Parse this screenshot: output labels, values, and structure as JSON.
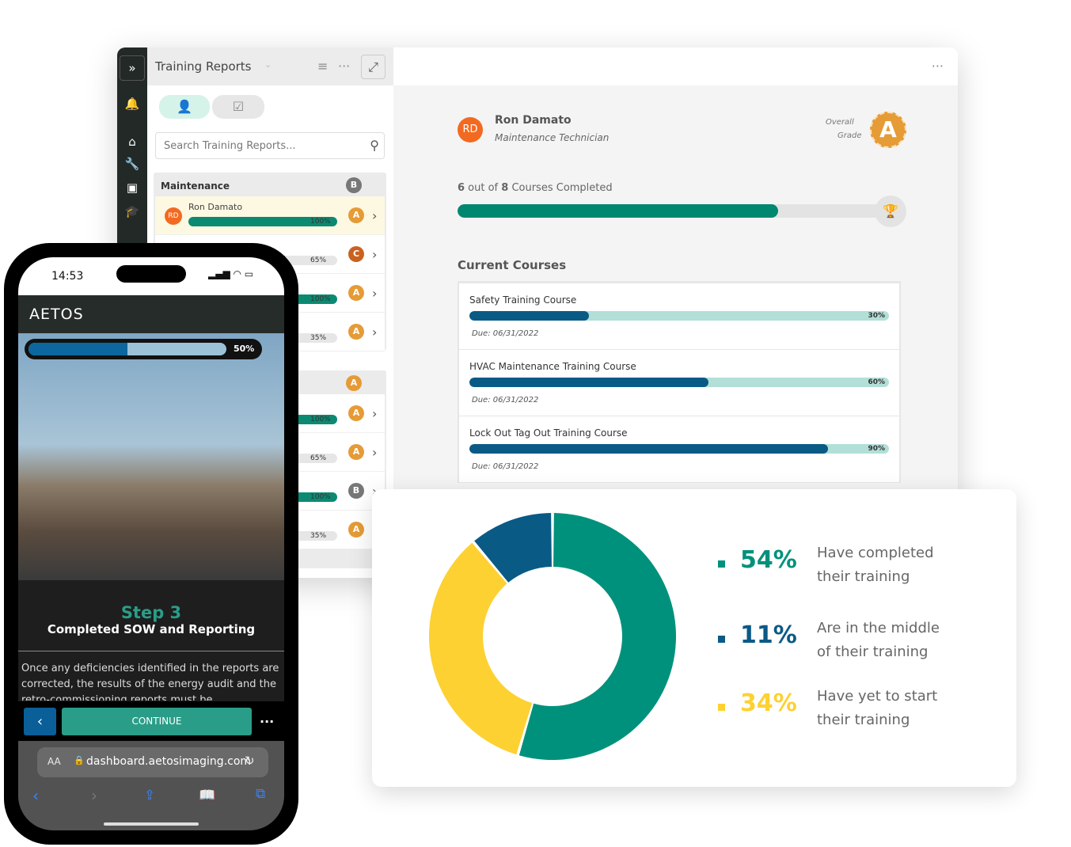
{
  "desktop": {
    "panel_title": "Training Reports",
    "search_placeholder": "Search Training Reports...",
    "group1": {
      "name": "Maintenance",
      "grade": "B",
      "rows": [
        {
          "initials": "RD",
          "name": "Ron Damato",
          "progress": 100,
          "pct": "100%",
          "grade": "A"
        },
        {
          "progress": 65,
          "pct": "65%",
          "grade": "C"
        },
        {
          "progress": 100,
          "pct": "100%",
          "grade": "A"
        },
        {
          "progress": 35,
          "pct": "35%",
          "grade": "A"
        }
      ]
    },
    "group2": {
      "grade": "A",
      "rows": [
        {
          "progress": 100,
          "pct": "100%",
          "grade": "A"
        },
        {
          "progress": 65,
          "pct": "65%",
          "grade": "A"
        },
        {
          "progress": 100,
          "pct": "100%",
          "grade": "B"
        },
        {
          "progress": 35,
          "pct": "35%",
          "grade": "A"
        }
      ]
    },
    "profile": {
      "initials": "RD",
      "name": "Ron Damato",
      "role": "Maintenance Technician",
      "overall_label_1": "Overall",
      "overall_label_2": "Grade",
      "overall_grade": "A"
    },
    "completion": {
      "done": "6",
      "out_of": " out of ",
      "total": "8",
      "suffix": " Courses Completed",
      "fraction": 0.75
    },
    "current_courses_title": "Current Courses",
    "courses": [
      {
        "name": "Safety Training Course",
        "progress": 30,
        "pct": "30%",
        "due": "Due: 06/31/2022"
      },
      {
        "name": "HVAC Maintenance Training Course",
        "progress": 60,
        "pct": "60%",
        "due": "Due: 06/31/2022"
      },
      {
        "name": "Lock Out Tag Out Training Course",
        "progress": 90,
        "pct": "90%",
        "due": "Due: 06/31/2022"
      }
    ]
  },
  "phone": {
    "time": "14:53",
    "logo": "AETOS",
    "progress": 50,
    "progress_label": "50%",
    "step": "Step 3",
    "step_title": "Completed SOW and Reporting",
    "body": "Once any deficiencies identified in the reports are corrected, the results of the energy audit and the retro-commissioning reports must be",
    "continue": "CONTINUE",
    "text_size": "AA",
    "url": "dashboard.aetosimaging.com"
  },
  "chart_data": {
    "type": "pie",
    "series": [
      {
        "value": 54,
        "label": "54%",
        "text1": "Have completed",
        "text2": "their training",
        "color": "#00917c"
      },
      {
        "value": 11,
        "label": "11%",
        "text1": "Are in the middle",
        "text2": "of their training",
        "color": "#0a5a86"
      },
      {
        "value": 34,
        "label": "34%",
        "text1": "Have yet to start",
        "text2": "their training",
        "color": "#fdd131"
      }
    ]
  }
}
